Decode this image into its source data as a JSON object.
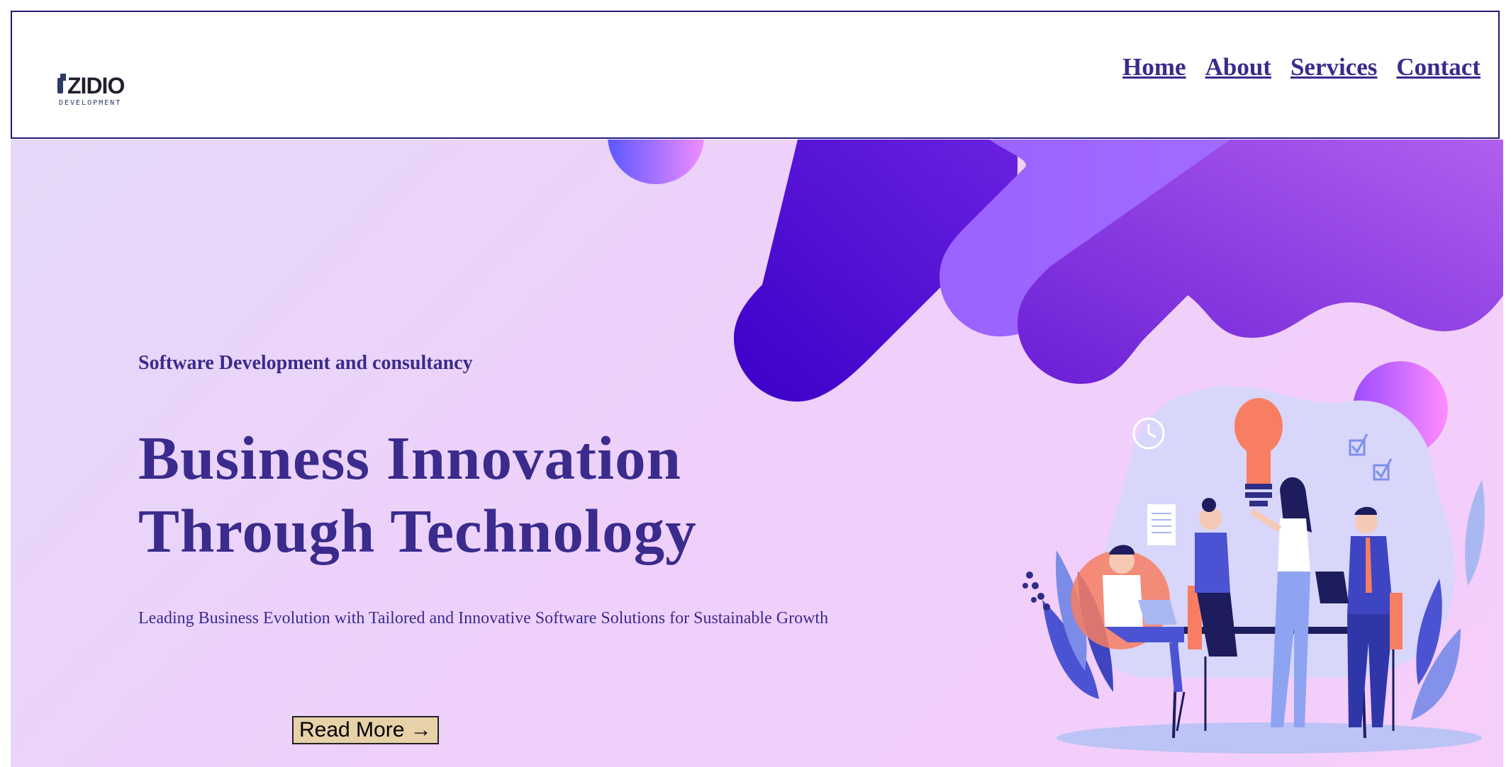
{
  "brand": {
    "logo_main": "ZIDIO",
    "logo_sub": "DEVELOPMENT"
  },
  "nav": {
    "items": [
      "Home",
      "About",
      "Services",
      "Contact"
    ]
  },
  "hero": {
    "subtitle": "Software Development and consultancy",
    "title": "Business Innovation Through Technology",
    "description": "Leading Business Evolution with Tailored and Innovative Software Solutions for Sustainable Growth",
    "cta_label": "Read More →"
  },
  "colors": {
    "primary_text": "#3a2b8c",
    "header_border": "#1f1a7a",
    "button_bg": "#e6d1a8",
    "hero_bg_start": "#e6d8f8",
    "hero_bg_end": "#f6cefa",
    "accent_purple": "#5b1fd0"
  },
  "icons": {
    "illustration": "team-meeting-illustration",
    "lightbulb": "lightbulb-icon",
    "clock": "clock-icon",
    "checkbox": "checkbox-icon",
    "document": "document-icon"
  }
}
